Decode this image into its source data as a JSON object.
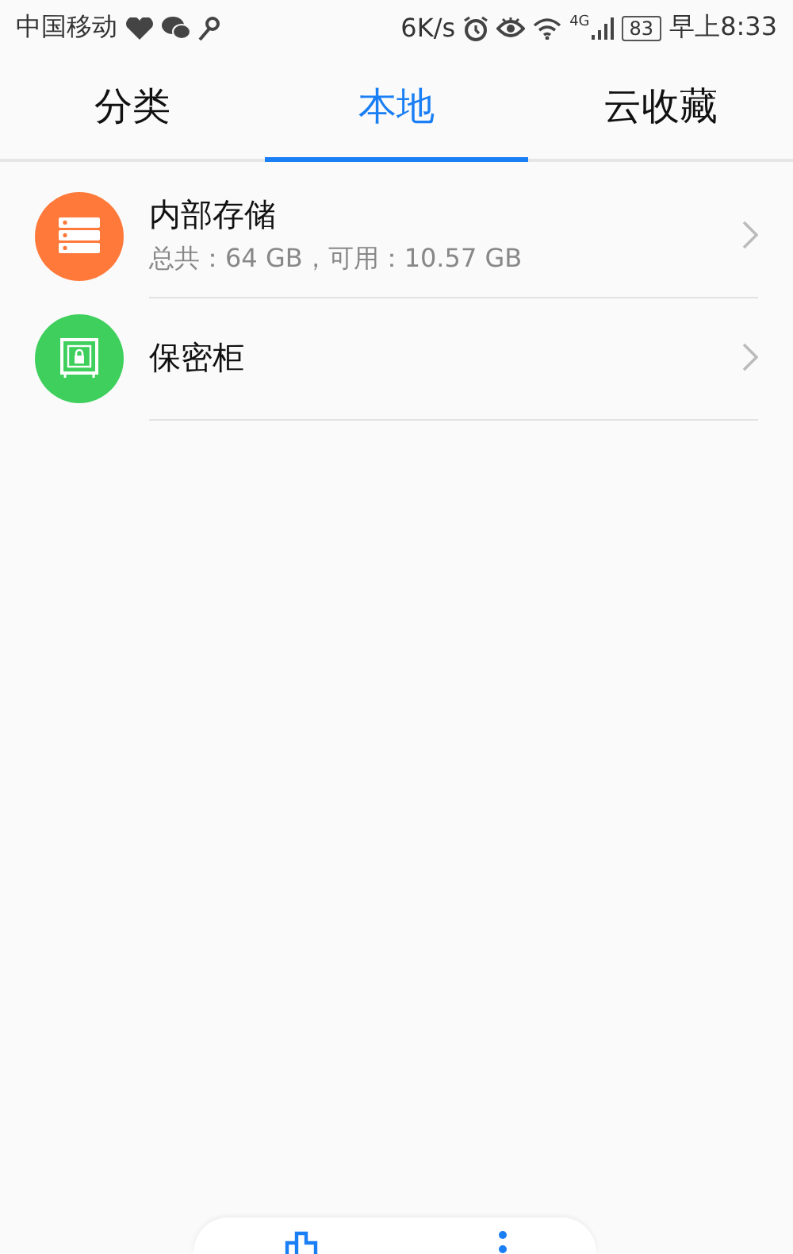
{
  "status_bar": {
    "carrier": "中国移动",
    "speed": "6K/s",
    "network": "4G",
    "battery": "83",
    "time": "早上8:33"
  },
  "tabs": [
    {
      "label": "分类",
      "selected": false
    },
    {
      "label": "本地",
      "selected": true
    },
    {
      "label": "云收藏",
      "selected": false
    }
  ],
  "items": [
    {
      "kind": "storage",
      "title": "内部存储",
      "subtitle": "总共：64 GB，可用：10.57 GB",
      "color": "#ff7a3a"
    },
    {
      "kind": "safe",
      "title": "保密柜",
      "color": "#3ecf5c"
    }
  ],
  "bottom_bar": {
    "buttons": [
      {
        "kind": "clean"
      },
      {
        "kind": "more"
      }
    ]
  }
}
